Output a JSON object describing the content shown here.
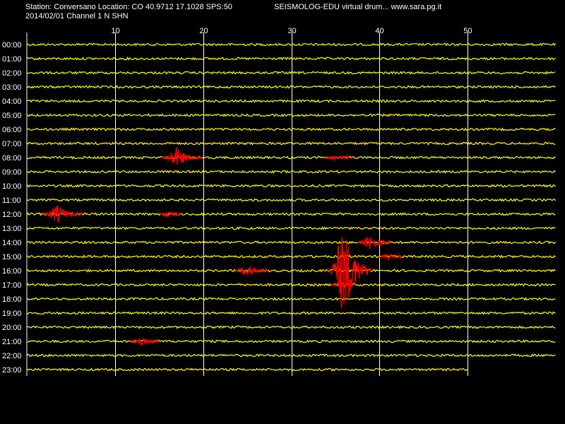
{
  "header": {
    "station_line": "Station: Conversano Location: CO 40.9712 17.1028 SPS:50",
    "date_line": "2014/02/01  Channel 1 N SHN",
    "software_line": "SEISMOLOG-EDU virtual drum... www.sara.pg.it"
  },
  "colors": {
    "background": "#000000",
    "trace": "#ffff00",
    "event": "#ff0000",
    "grid": "#ffffff",
    "text": "#ffffff"
  },
  "chart_data": {
    "type": "line",
    "xlabel": "",
    "ylabel": "",
    "x_unit_minutes_range": [
      0,
      60
    ],
    "x_ticks": [
      10,
      20,
      30,
      40,
      50
    ],
    "x_tick_labels": [
      "10",
      "20",
      "30",
      "40",
      "50"
    ],
    "rows": [
      "00:00",
      "01:00",
      "02:00",
      "03:00",
      "04:00",
      "05:00",
      "06:00",
      "07:00",
      "08:00",
      "09:00",
      "10:00",
      "11:00",
      "12:00",
      "13:00",
      "14:00",
      "15:00",
      "16:00",
      "17:00",
      "18:00",
      "19:00",
      "20:00",
      "21:00",
      "22:00",
      "23:00"
    ],
    "last_row_end_minute": 50,
    "grid": true,
    "events": [
      {
        "row": "08:00",
        "center_minute": 17,
        "width_minutes": 3.5,
        "amplitude": 13
      },
      {
        "row": "08:00",
        "center_minute": 35,
        "width_minutes": 2.5,
        "amplitude": 4
      },
      {
        "row": "12:00",
        "center_minute": 3.5,
        "width_minutes": 3.5,
        "amplitude": 11
      },
      {
        "row": "12:00",
        "center_minute": 16,
        "width_minutes": 2,
        "amplitude": 3
      },
      {
        "row": "14:00",
        "center_minute": 39,
        "width_minutes": 3,
        "amplitude": 9
      },
      {
        "row": "15:00",
        "center_minute": 41,
        "width_minutes": 2,
        "amplitude": 3
      },
      {
        "row": "16:00",
        "center_minute": 25,
        "width_minutes": 3,
        "amplitude": 7
      },
      {
        "row": "16:00",
        "center_minute": 36,
        "width_minutes": 4,
        "amplitude": 60
      },
      {
        "row": "17:00",
        "center_minute": 35.5,
        "width_minutes": 2,
        "amplitude": 6
      },
      {
        "row": "21:00",
        "center_minute": 13,
        "width_minutes": 2.5,
        "amplitude": 5
      }
    ]
  }
}
